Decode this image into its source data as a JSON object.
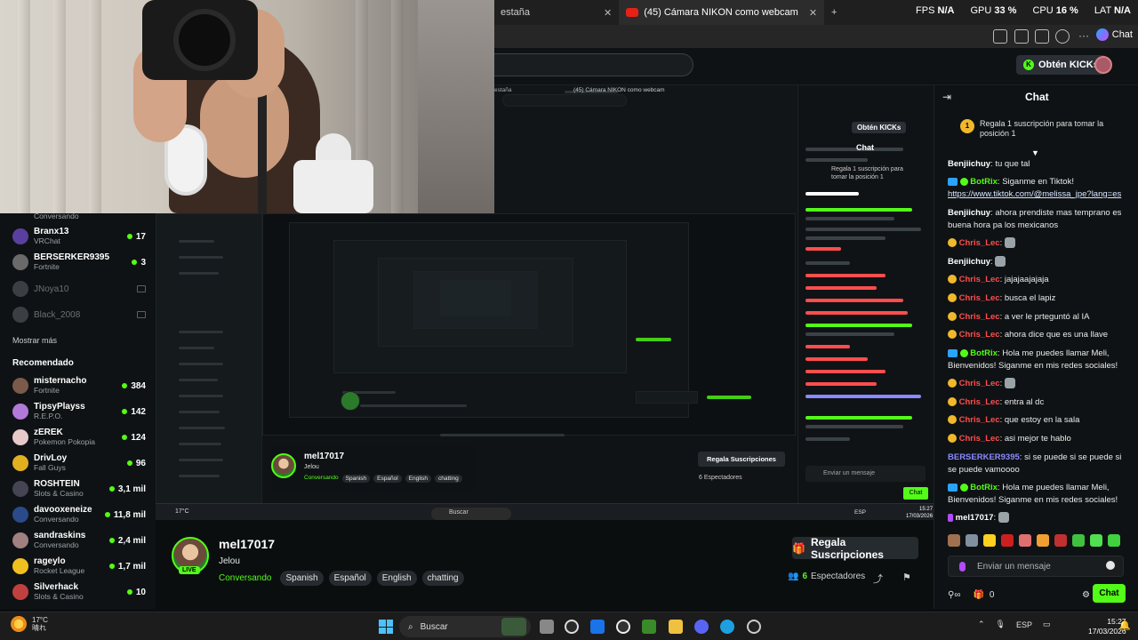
{
  "browser": {
    "tabs": [
      {
        "label": "estaña",
        "active": false
      },
      {
        "label": "(45) Cámara NIKON como webcam",
        "active": true
      }
    ],
    "new_tab_icon": "+",
    "perf": [
      {
        "label": "FPS",
        "value": "N/A"
      },
      {
        "label": "GPU",
        "value": "33 %"
      },
      {
        "label": "CPU",
        "value": "16 %"
      },
      {
        "label": "LAT",
        "value": "N/A"
      }
    ],
    "chat_button": "Chat"
  },
  "header": {
    "get_kicks": "Obtén KICKs"
  },
  "sidebar": {
    "top_partial": "Conversando",
    "following": [
      {
        "name": "Branx13",
        "category": "VRChat",
        "count": "17",
        "live": true,
        "color": "#5a3fa0"
      },
      {
        "name": "BERSERKER9395",
        "category": "Fortnite",
        "count": "3",
        "live": true,
        "color": "#6a6a6a"
      },
      {
        "name": "JNoya10",
        "category": "",
        "count": "",
        "live": false,
        "color": "#3a3f43"
      },
      {
        "name": "Black_2008",
        "category": "",
        "count": "",
        "live": false,
        "color": "#3a3f43"
      }
    ],
    "show_more": "Mostrar más",
    "recommended_title": "Recomendado",
    "recommended": [
      {
        "name": "misternacho",
        "category": "Fortnite",
        "count": "384",
        "color": "#7a5a4a"
      },
      {
        "name": "TipsyPlayss",
        "category": "R.E.P.O.",
        "count": "142",
        "color": "#b27ad8"
      },
      {
        "name": "zEREK",
        "category": "Pokemon Pokopia",
        "count": "124",
        "color": "#e6c9c9"
      },
      {
        "name": "DrivLoy",
        "category": "Fall Guys",
        "count": "96",
        "color": "#e0b020"
      },
      {
        "name": "ROSHTEIN",
        "category": "Slots & Casino",
        "count": "3,1 mil",
        "color": "#445"
      },
      {
        "name": "davooxeneize",
        "category": "Conversando",
        "count": "11,8 mil",
        "color": "#2a4a8a"
      },
      {
        "name": "sandraskins",
        "category": "Conversando",
        "count": "2,4 mil",
        "color": "#a08080"
      },
      {
        "name": "rageylo",
        "category": "Rocket League",
        "count": "1,7 mil",
        "color": "#f0c020"
      },
      {
        "name": "Silverhack",
        "category": "Slots & Casino",
        "count": "10",
        "color": "#c04040"
      }
    ]
  },
  "stream": {
    "streamer": "mel17017",
    "title": "Jelou",
    "category": "Conversando",
    "tags": [
      "Spanish",
      "Español",
      "English",
      "chatting"
    ],
    "live_badge": "LIVE",
    "gift_subs": "Regala Suscripciones",
    "viewers_count": "6",
    "viewers_label": "Espectadores"
  },
  "nested": {
    "streamer": "mel17017",
    "title": "Jelou",
    "category": "Conversando",
    "tags": [
      "Spanish",
      "Español",
      "English",
      "chatting"
    ],
    "gift_subs": "Regala Suscripciones",
    "viewers": "6 Espectadores",
    "weather": "17°C",
    "search": "Buscar",
    "lang": "ESP",
    "clock_time": "15:27",
    "clock_date": "17/03/2026",
    "chat_placeholder": "Enviar un mensaje",
    "chat_send": "Chat",
    "chat_title": "Chat",
    "pinned": "Regala 1 suscripción para tomar la posición 1",
    "get_kicks": "Obtén KICKs",
    "tab": "(45) Cámara NIKON como webcam",
    "tab_prev": "estaña"
  },
  "chat": {
    "title": "Chat",
    "pinned_coin": "1",
    "pinned_text": "Regala 1 suscripción para tomar la posición 1",
    "messages": [
      {
        "user": "Benjiichuy",
        "color": "#ffffff",
        "text": "tu que tal",
        "badges": []
      },
      {
        "user": "BotRix",
        "color": "#53fc18",
        "text": "Siganme en Tiktok!",
        "link": "https://www.tiktok.com/@melissa_jpe?lang=es",
        "badges": [
          "bot",
          "verified"
        ]
      },
      {
        "user": "Benjiichuy",
        "color": "#ffffff",
        "text": "ahora prendiste mas temprano es buena hora pa los mexicanos",
        "badges": []
      },
      {
        "user": "Chris_Lec",
        "color": "#ff4d4d",
        "text": "",
        "emote": true,
        "badges": [
          "sub"
        ]
      },
      {
        "user": "Benjiichuy",
        "color": "#ffffff",
        "text": "",
        "emote": true,
        "badges": []
      },
      {
        "user": "Chris_Lec",
        "color": "#ff4d4d",
        "text": "jajajaajajaja",
        "badges": [
          "sub"
        ]
      },
      {
        "user": "Chris_Lec",
        "color": "#ff4d4d",
        "text": "busca el lapiz",
        "badges": [
          "sub"
        ]
      },
      {
        "user": "Chris_Lec",
        "color": "#ff4d4d",
        "text": "a ver le prteguntó al IA",
        "badges": [
          "sub"
        ]
      },
      {
        "user": "Chris_Lec",
        "color": "#ff4d4d",
        "text": "ahora dice que es una llave",
        "badges": [
          "sub"
        ]
      },
      {
        "user": "BotRix",
        "color": "#53fc18",
        "text": "Hola me puedes llamar Meli, Bienvenidos! Siganme en mis redes sociales!",
        "badges": [
          "bot",
          "verified"
        ]
      },
      {
        "user": "Chris_Lec",
        "color": "#ff4d4d",
        "text": "",
        "emote": true,
        "badges": [
          "sub"
        ]
      },
      {
        "user": "Chris_Lec",
        "color": "#ff4d4d",
        "text": "entra al dc",
        "badges": [
          "sub"
        ]
      },
      {
        "user": "Chris_Lec",
        "color": "#ff4d4d",
        "text": "que estoy en la sala",
        "badges": [
          "sub"
        ]
      },
      {
        "user": "Chris_Lec",
        "color": "#ff4d4d",
        "text": "asi mejor te hablo",
        "badges": [
          "sub"
        ]
      },
      {
        "user": "BERSERKER9395",
        "color": "#8a8aff",
        "text": "si se puede si se puede si se puede vamoooo",
        "badges": []
      },
      {
        "user": "BotRix",
        "color": "#53fc18",
        "text": "Hola me puedes llamar Meli, Bienvenidos! Siganme en mis redes sociales!",
        "badges": [
          "bot",
          "verified"
        ]
      },
      {
        "user": "mel17017",
        "color": "#ffffff",
        "text": "",
        "emote": true,
        "badges": [
          "mic"
        ]
      }
    ],
    "input_placeholder": "Enviar un mensaje",
    "send_button": "Chat",
    "bottom_count": "0"
  },
  "taskbar": {
    "weather_temp": "17°C",
    "weather_desc": "晴れ",
    "search": "Buscar",
    "lang": "ESP",
    "time": "15:27",
    "date": "17/03/2026"
  }
}
